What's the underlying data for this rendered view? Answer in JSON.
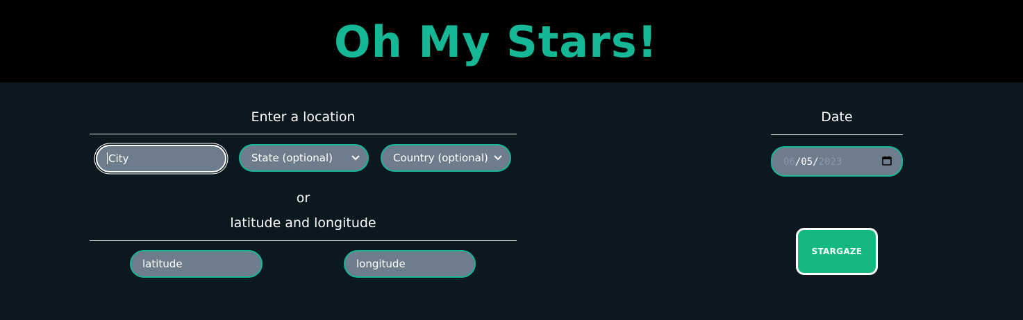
{
  "header": {
    "title": "Oh My Stars!"
  },
  "location": {
    "heading": "Enter a location",
    "city": {
      "placeholder": "City"
    },
    "state": {
      "selected": "State (optional)"
    },
    "country": {
      "selected": "Country (optional)"
    },
    "or_label": "or",
    "latlon_heading": "latitude and longitude",
    "latitude": {
      "placeholder": "latitude"
    },
    "longitude": {
      "placeholder": "longitude"
    }
  },
  "date": {
    "heading": "Date",
    "month": "06",
    "day": "05",
    "year": "2023",
    "sep": "/"
  },
  "action": {
    "submit_label": "STARGAZE"
  },
  "colors": {
    "accent": "#16b795",
    "button": "#16b882",
    "header_bg": "#000000",
    "page_bg": "#0b1820",
    "field_bg": "#6e7d8c"
  },
  "icons": [
    "chevron-down-icon",
    "calendar-icon"
  ]
}
